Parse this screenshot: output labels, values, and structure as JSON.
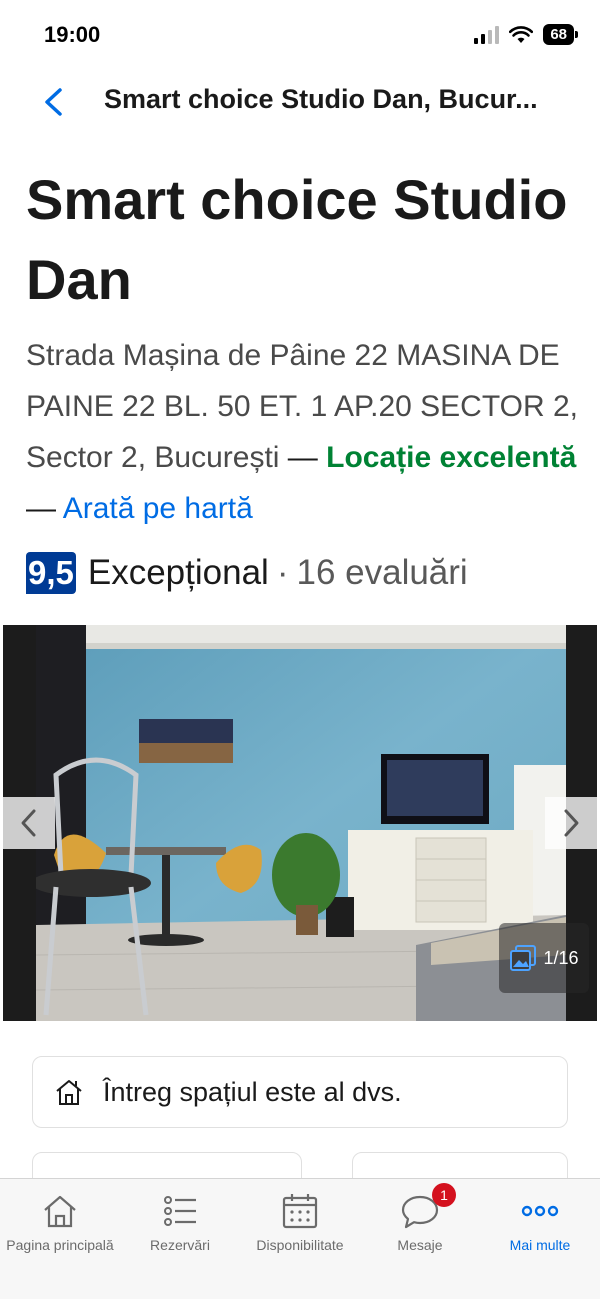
{
  "status_bar": {
    "time": "19:00",
    "battery": "68"
  },
  "header": {
    "title": "Smart choice Studio Dan, Bucur..."
  },
  "property": {
    "name": "Smart choice Studio Dan",
    "address": "Strada Mașina de Pâine 22 MASINA DE PAINE 22 BL. 50 ET. 1 AP.20 SECTOR 2, Sector 2, București",
    "dash1": "—",
    "location_rating": "Locație excelentă",
    "dash2": "—",
    "map_link": "Arată pe hartă"
  },
  "rating": {
    "score": "9,5",
    "word": "Excepțional",
    "separator": "·",
    "reviews": "16 evaluări"
  },
  "gallery": {
    "counter": "1/16"
  },
  "cards": {
    "entire_place": "Întreg spațiul este al dvs."
  },
  "tabs": [
    {
      "label": "Pagina principală",
      "icon": "home-icon"
    },
    {
      "label": "Rezervări",
      "icon": "list-icon"
    },
    {
      "label": "Disponibilitate",
      "icon": "calendar-icon"
    },
    {
      "label": "Mesaje",
      "icon": "chat-icon",
      "badge": "1"
    },
    {
      "label": "Mai multe",
      "icon": "more-icon",
      "active": true
    }
  ],
  "colors": {
    "accent": "#006ce4",
    "score_badge": "#003b95",
    "location_green": "#008234",
    "message_badge": "#d4111e"
  }
}
